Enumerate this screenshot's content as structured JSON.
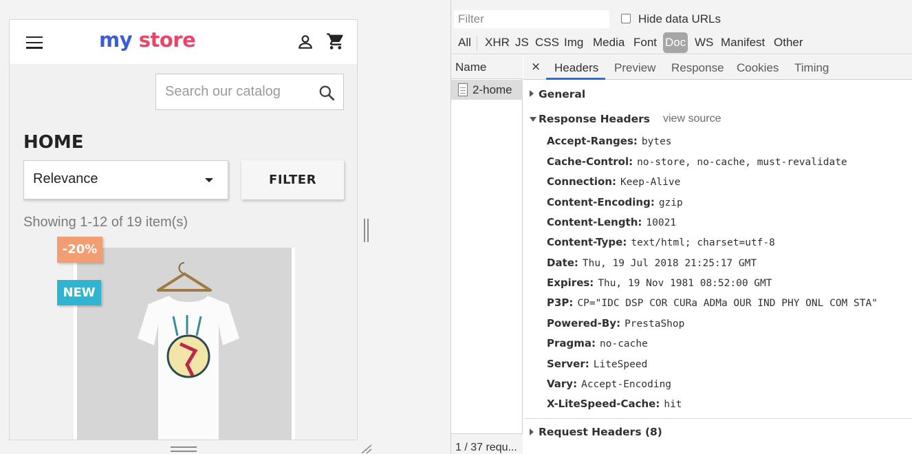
{
  "store": {
    "logo_word1": "my",
    "logo_word2": "store",
    "search_placeholder": "Search our catalog",
    "page_title": "HOME",
    "sort_value": "Relevance",
    "filter_label": "FILTER",
    "showing_text": "Showing 1-12 of 19 item(s)",
    "product": {
      "badge_discount": "-20%",
      "badge_new": "NEW"
    },
    "colors": {
      "logo_blue": "#3a5fd4",
      "logo_pink": "#e8456a",
      "discount_badge": "#f39d72",
      "new_badge": "#2fb5d2"
    }
  },
  "devtools": {
    "filter_placeholder": "Filter",
    "hide_data_urls_label": "Hide data URLs",
    "type_filters": [
      "All",
      "XHR",
      "JS",
      "CSS",
      "Img",
      "Media",
      "Font",
      "Doc",
      "WS",
      "Manifest",
      "Other"
    ],
    "active_type_filter": "Doc",
    "name_header": "Name",
    "request_name": "2-home",
    "status_text": "1 / 37 requ...",
    "close_symbol": "×",
    "tabs": [
      "Headers",
      "Preview",
      "Response",
      "Cookies",
      "Timing"
    ],
    "active_tab": "Headers",
    "sections": {
      "general": "General",
      "response_headers": "Response Headers",
      "view_source": "view source",
      "request_headers": "Request Headers (8)"
    },
    "response_headers": [
      {
        "name": "Accept-Ranges:",
        "value": "bytes"
      },
      {
        "name": "Cache-Control:",
        "value": "no-store, no-cache, must-revalidate"
      },
      {
        "name": "Connection:",
        "value": "Keep-Alive"
      },
      {
        "name": "Content-Encoding:",
        "value": "gzip"
      },
      {
        "name": "Content-Length:",
        "value": "10021"
      },
      {
        "name": "Content-Type:",
        "value": "text/html; charset=utf-8"
      },
      {
        "name": "Date:",
        "value": "Thu, 19 Jul 2018 21:25:17 GMT"
      },
      {
        "name": "Expires:",
        "value": "Thu, 19 Nov 1981 08:52:00 GMT"
      },
      {
        "name": "P3P:",
        "value": "CP=\"IDC DSP COR CURa ADMa OUR IND PHY ONL COM STA\""
      },
      {
        "name": "Powered-By:",
        "value": "PrestaShop"
      },
      {
        "name": "Pragma:",
        "value": "no-cache"
      },
      {
        "name": "Server:",
        "value": "LiteSpeed"
      },
      {
        "name": "Vary:",
        "value": "Accept-Encoding"
      },
      {
        "name": "X-LiteSpeed-Cache:",
        "value": "hit"
      }
    ],
    "colors": {
      "active_tab_underline": "#1a73e8",
      "active_filter_bg": "#a6a6a6"
    }
  }
}
